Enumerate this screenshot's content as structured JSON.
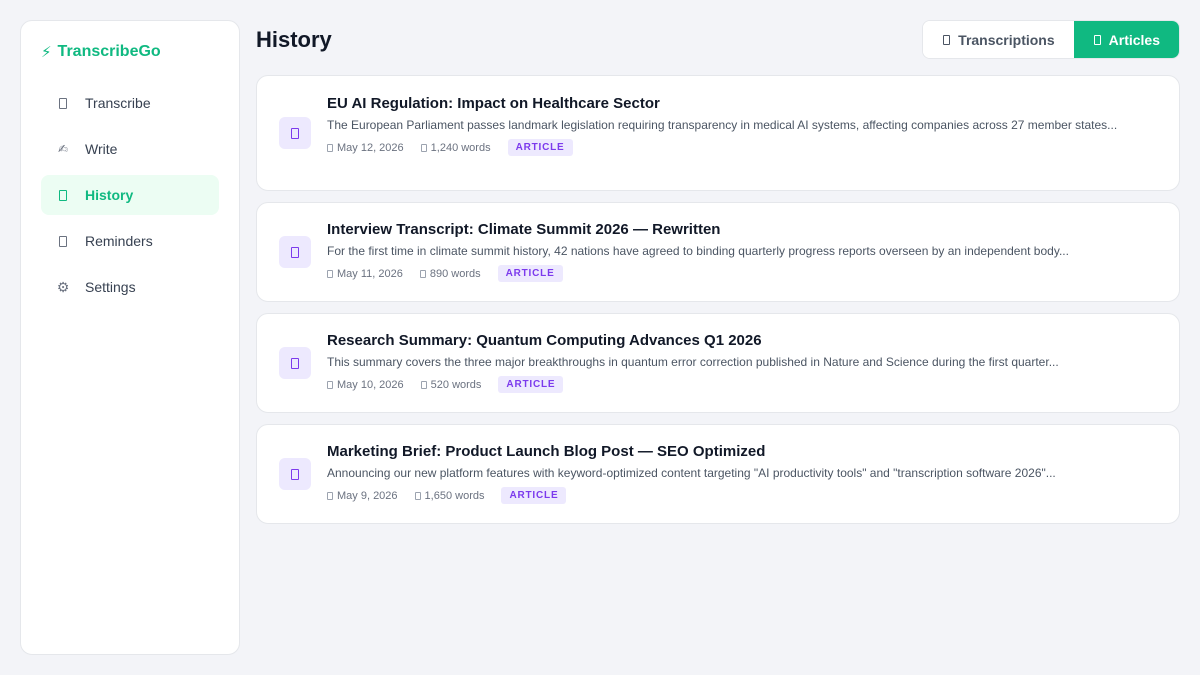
{
  "app": {
    "name": "TranscribeGo",
    "accent": "#10b981"
  },
  "sidebar": {
    "items": [
      {
        "label": "Transcribe",
        "icon": "document-icon"
      },
      {
        "label": "Write",
        "icon": "pen-icon"
      },
      {
        "label": "History",
        "icon": "history-icon",
        "active": true
      },
      {
        "label": "Reminders",
        "icon": "bell-icon"
      },
      {
        "label": "Settings",
        "icon": "gear-icon"
      }
    ]
  },
  "header": {
    "title": "History",
    "tabs": [
      {
        "label": "Transcriptions",
        "active": false
      },
      {
        "label": "Articles",
        "active": true
      }
    ]
  },
  "items": [
    {
      "title": "EU AI Regulation: Impact on Healthcare Sector",
      "desc": "The European Parliament passes landmark legislation requiring transparency in medical AI systems, affecting companies across 27 member states...",
      "date": "May 12, 2026",
      "words": "1,240 words",
      "badge": "ARTICLE"
    },
    {
      "title": "Interview Transcript: Climate Summit 2026 — Rewritten",
      "desc": "For the first time in climate summit history, 42 nations have agreed to binding quarterly progress reports overseen by an independent body...",
      "date": "May 11, 2026",
      "words": "890 words",
      "badge": "ARTICLE"
    },
    {
      "title": "Research Summary: Quantum Computing Advances Q1 2026",
      "desc": "This summary covers the three major breakthroughs in quantum error correction published in Nature and Science during the first quarter...",
      "date": "May 10, 2026",
      "words": "520 words",
      "badge": "ARTICLE"
    },
    {
      "title": "Marketing Brief: Product Launch Blog Post — SEO Optimized",
      "desc": "Announcing our new platform features with keyword-optimized content targeting \"AI productivity tools\" and \"transcription software 2026\"...",
      "date": "May 9, 2026",
      "words": "1,650 words",
      "badge": "ARTICLE"
    }
  ]
}
